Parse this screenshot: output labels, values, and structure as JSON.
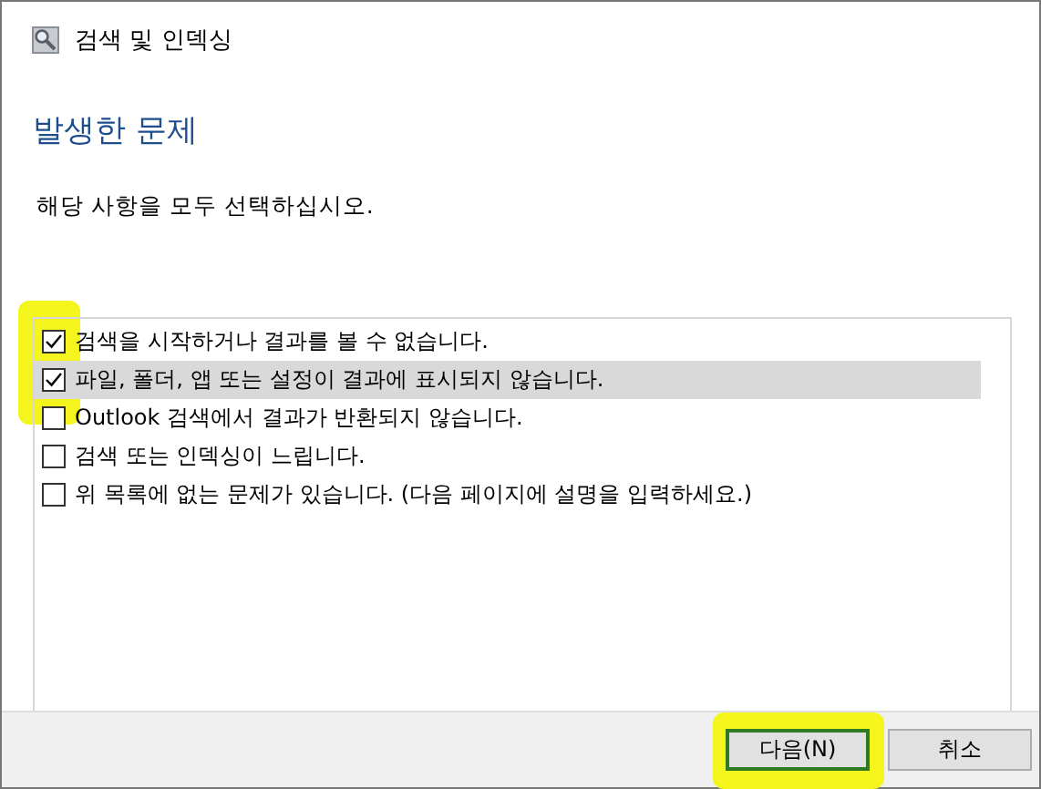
{
  "window": {
    "title": "검색 및 인덱싱"
  },
  "heading": "발생한 문제",
  "instruction": "해당 사항을 모두 선택하십시오.",
  "problems": [
    {
      "label": "검색을 시작하거나 결과를 볼 수 없습니다.",
      "checked": true,
      "selected": false
    },
    {
      "label": "파일, 폴더, 앱 또는 설정이 결과에 표시되지 않습니다.",
      "checked": true,
      "selected": true
    },
    {
      "label": "Outlook 검색에서 결과가 반환되지 않습니다.",
      "checked": false,
      "selected": false
    },
    {
      "label": "검색 또는 인덱싱이 느립니다.",
      "checked": false,
      "selected": false
    },
    {
      "label": "위 목록에 없는 문제가 있습니다. (다음 페이지에 설명을 입력하세요.)",
      "checked": false,
      "selected": false
    }
  ],
  "buttons": [
    {
      "label": "다음(N)",
      "default": true
    },
    {
      "label": "취소",
      "default": false
    }
  ]
}
